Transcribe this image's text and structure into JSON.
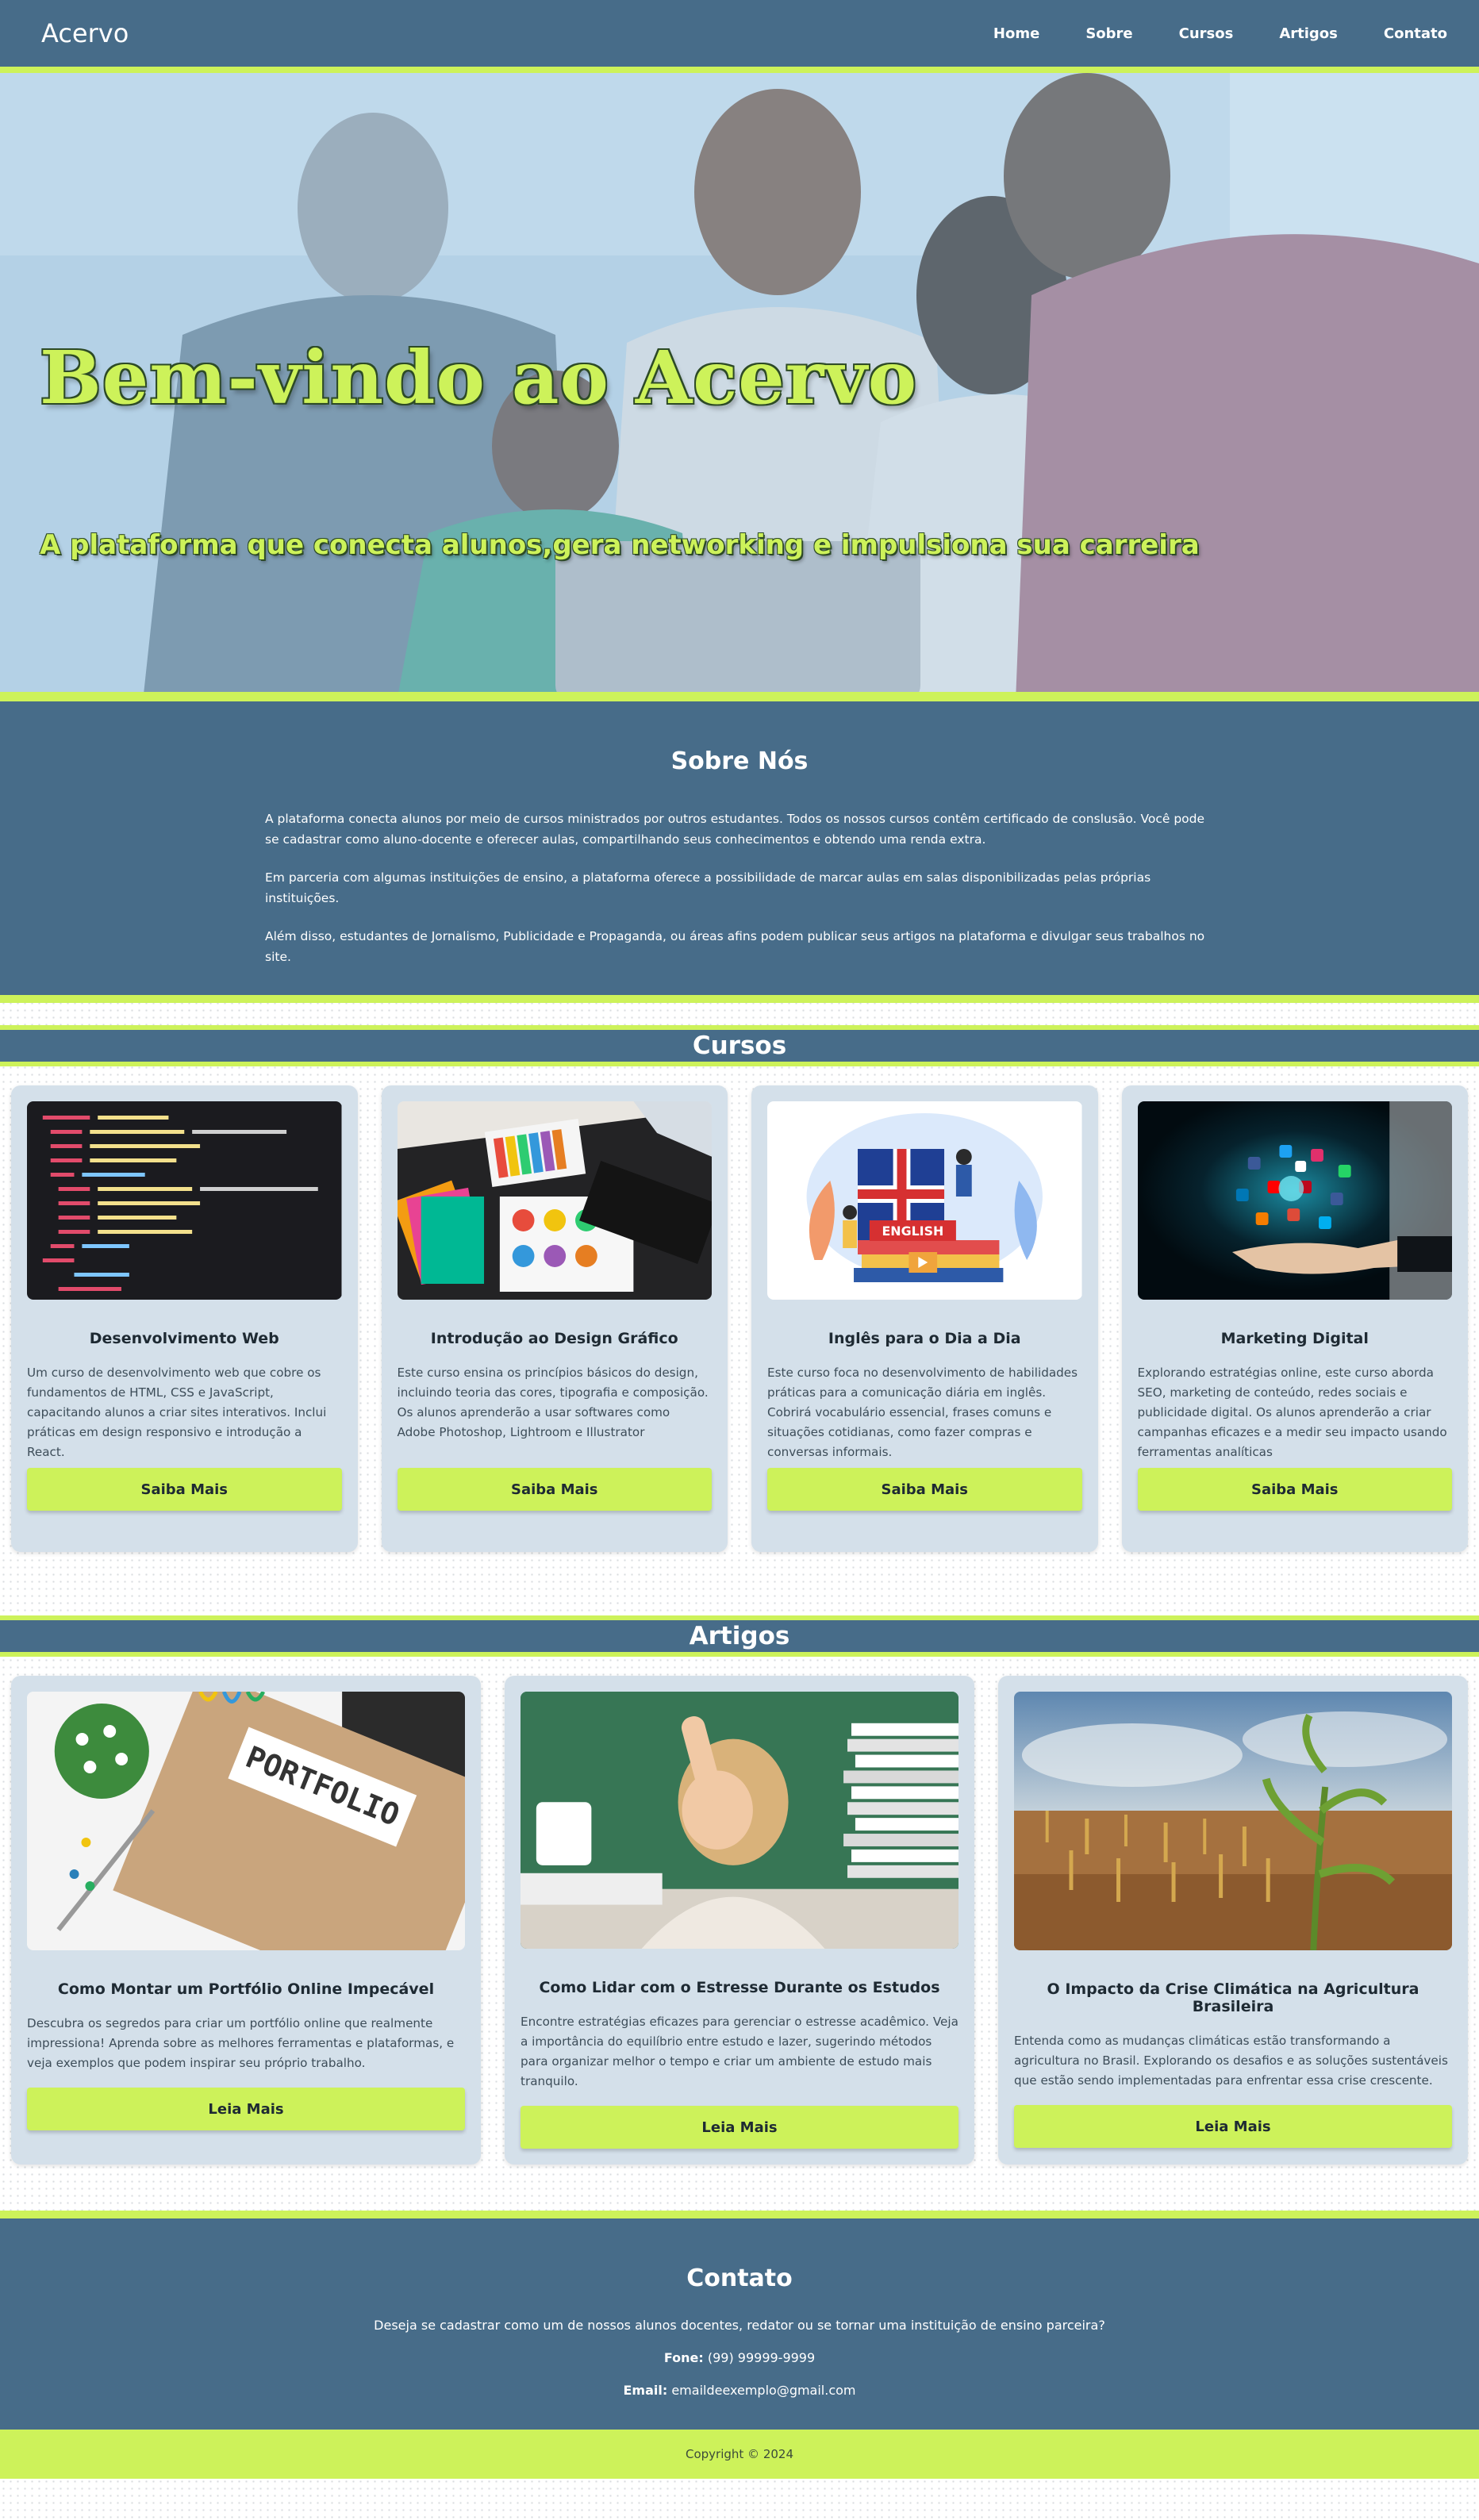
{
  "header": {
    "brand": "Acervo",
    "nav": [
      "Home",
      "Sobre",
      "Cursos",
      "Artigos",
      "Contato"
    ]
  },
  "hero": {
    "title": "Bem-vindo ao Acervo",
    "subtitle": "A plataforma que conecta alunos,gera networking e impulsiona sua carreira"
  },
  "about": {
    "title": "Sobre Nós",
    "paragraphs": [
      "A plataforma conecta alunos por meio de cursos ministrados por outros estudantes. Todos os nossos cursos contêm certificado de conslusão. Você pode se cadastrar como aluno-docente e oferecer aulas, compartilhando seus conhecimentos e obtendo uma renda extra.",
      "Em parceria com algumas instituições de ensino, a plataforma oferece a possibilidade de marcar aulas em salas disponibilizadas pelas próprias instituições.",
      "Além disso, estudantes de Jornalismo, Publicidade e Propaganda, ou áreas afins podem publicar seus artigos na plataforma e divulgar seus trabalhos no site."
    ]
  },
  "courses": {
    "title": "Cursos",
    "items": [
      {
        "title": "Desenvolvimento Web",
        "text": "Um curso de desenvolvimento web que cobre os fundamentos de HTML, CSS e JavaScript, capacitando alunos a criar sites interativos. Inclui práticas em design responsivo e introdução a React.",
        "button": "Saiba Mais",
        "image_icon": "code-screen-image"
      },
      {
        "title": "Introdução ao Design Gráfico",
        "text": "Este curso ensina os princípios básicos do design, incluindo teoria das cores, tipografia e composição. Os alunos aprenderão a usar softwares como Adobe Photoshop, Lightroom e Illustrator",
        "button": "Saiba Mais",
        "image_icon": "design-desk-image"
      },
      {
        "title": "Inglês para o Dia a Dia",
        "text": "Este curso foca no desenvolvimento de habilidades práticas para a comunicação diária em inglês. Cobrirá vocabulário essencial, frases comuns e situações cotidianas, como fazer compras e conversas informais.",
        "button": "Saiba Mais",
        "image_icon": "english-books-image",
        "image_label": "ENGLISH"
      },
      {
        "title": "Marketing Digital",
        "text": "Explorando estratégias online, este curso aborda SEO, marketing de conteúdo, redes sociais e publicidade digital. Os alunos aprenderão a criar campanhas eficazes e a medir seu impacto usando ferramentas analíticas",
        "button": "Saiba Mais",
        "image_icon": "social-media-hand-image"
      }
    ]
  },
  "articles": {
    "title": "Artigos",
    "items": [
      {
        "title": "Como Montar um Portfólio Online Impecável",
        "text": "Descubra os segredos para criar um portfólio online que realmente impressiona! Aprenda sobre as melhores ferramentas e plataformas, e veja exemplos que podem inspirar seu próprio trabalho.",
        "button": "Leia Mais",
        "image_icon": "portfolio-folder-image",
        "image_label": "PORTFOLIO"
      },
      {
        "title": "Como Lidar com o Estresse Durante os Estudos",
        "text": "Encontre estratégias eficazes para gerenciar o estresse acadêmico. Veja a importância do equilíbrio entre estudo e lazer, sugerindo métodos para organizar melhor o tempo e criar um ambiente de estudo mais tranquilo.",
        "button": "Leia Mais",
        "image_icon": "stressed-student-image"
      },
      {
        "title": "O Impacto da Crise Climática na Agricultura Brasileira",
        "text": "Entenda como as mudanças climáticas estão transformando a agricultura no Brasil. Explorando os desafios e as soluções sustentáveis que estão sendo implementadas para enfrentar essa crise crescente.",
        "button": "Leia Mais",
        "image_icon": "dry-cornfield-image"
      }
    ]
  },
  "contact": {
    "title": "Contato",
    "text": "Deseja se cadastrar como um de nossos alunos docentes, redator ou se tornar uma instituição de ensino parceira?",
    "phone_label": "Fone:",
    "phone": "(99) 99999-9999",
    "email_label": "Email:",
    "email": "emaildeexemplo@gmail.com"
  },
  "footer": {
    "copyright": "Copyright © 2024"
  },
  "colors": {
    "primary": "#476c89",
    "accent": "#cdf25a",
    "card": "#d4e0ea"
  }
}
